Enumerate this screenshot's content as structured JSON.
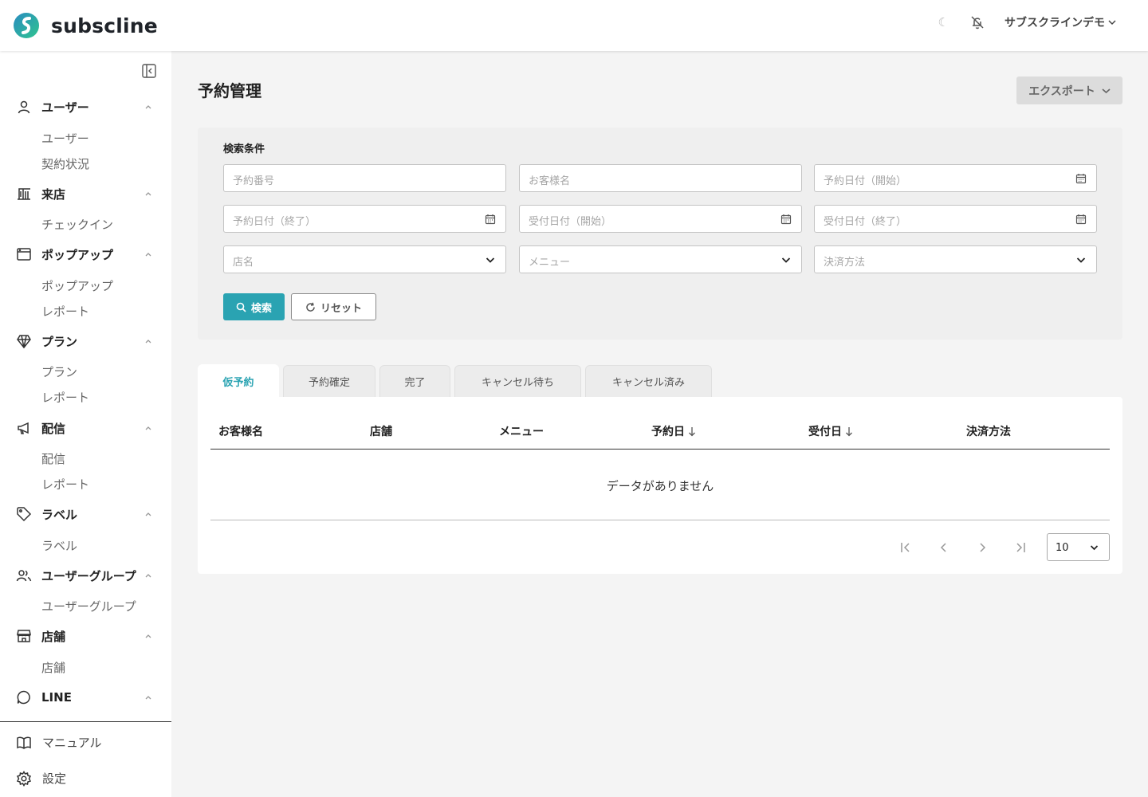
{
  "brand": {
    "name": "subscline",
    "accent": "#2aa3b2"
  },
  "header": {
    "theme_icon": "moon-icon",
    "user_name": "サブスクラインデモ"
  },
  "sidebar": {
    "groups": [
      {
        "label": "ユーザー",
        "icon": "user-icon",
        "items": [
          "ユーザー",
          "契約状況"
        ]
      },
      {
        "label": "来店",
        "icon": "building-icon",
        "items": [
          "チェックイン"
        ]
      },
      {
        "label": "ポップアップ",
        "icon": "window-icon",
        "items": [
          "ポップアップ",
          "レポート"
        ]
      },
      {
        "label": "プラン",
        "icon": "diamond-icon",
        "items": [
          "プラン",
          "レポート"
        ]
      },
      {
        "label": "配信",
        "icon": "megaphone-icon",
        "items": [
          "配信",
          "レポート"
        ]
      },
      {
        "label": "ラベル",
        "icon": "tag-icon",
        "items": [
          "ラベル"
        ]
      },
      {
        "label": "ユーザーグループ",
        "icon": "users-icon",
        "items": [
          "ユーザーグループ"
        ]
      },
      {
        "label": "店舗",
        "icon": "store-icon",
        "items": [
          "店舗"
        ]
      },
      {
        "label": "LINE",
        "icon": "chat-icon",
        "items": []
      }
    ],
    "bottom": [
      {
        "label": "マニュアル",
        "icon": "book-icon"
      },
      {
        "label": "設定",
        "icon": "gear-icon"
      }
    ]
  },
  "main": {
    "title": "予約管理",
    "export_label": "エクスポート",
    "search": {
      "title": "検索条件",
      "fields": [
        {
          "placeholder": "予約番号",
          "kind": "text"
        },
        {
          "placeholder": "お客様名",
          "kind": "text"
        },
        {
          "placeholder": "予約日付（開始）",
          "kind": "date"
        },
        {
          "placeholder": "予約日付（終了）",
          "kind": "date"
        },
        {
          "placeholder": "受付日付（開始）",
          "kind": "date"
        },
        {
          "placeholder": "受付日付（終了）",
          "kind": "date"
        },
        {
          "placeholder": "店名",
          "kind": "select"
        },
        {
          "placeholder": "メニュー",
          "kind": "select"
        },
        {
          "placeholder": "決済方法",
          "kind": "select"
        }
      ],
      "search_label": "検索",
      "reset_label": "リセット"
    },
    "tabs": [
      "仮予約",
      "予約確定",
      "完了",
      "キャンセル待ち",
      "キャンセル済み"
    ],
    "active_tab": "仮予約",
    "table": {
      "columns": [
        "お客様名",
        "店舗",
        "メニュー",
        "予約日",
        "受付日",
        "決済方法"
      ],
      "sortable": [
        "予約日",
        "受付日"
      ],
      "empty_message": "データがありません",
      "per_page": "10"
    }
  }
}
